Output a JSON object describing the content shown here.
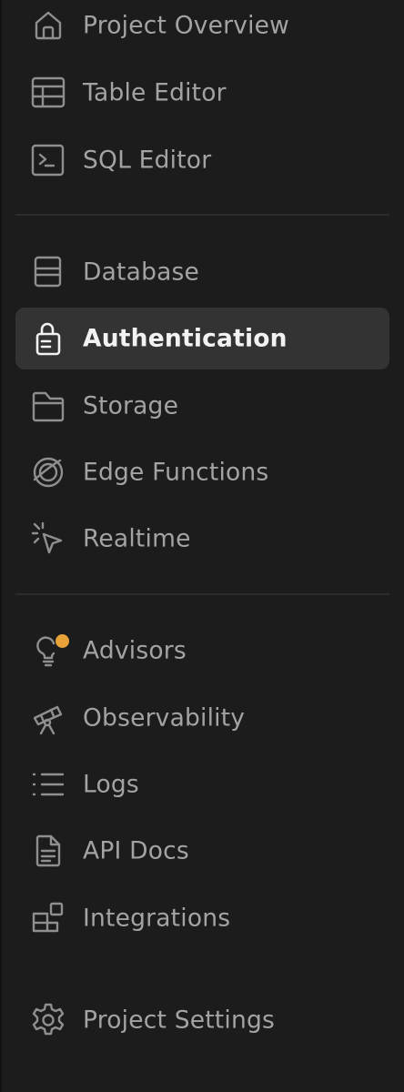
{
  "colors": {
    "background": "#1c1c1c",
    "active_background": "#333333",
    "text": "#a3a3a3",
    "active_text": "#f2f2f2",
    "icon": "#8f8f8f",
    "advisor_badge": "#e8a238"
  },
  "sidebar": {
    "groups": [
      {
        "items": [
          {
            "label": "Project Overview",
            "icon": "home-icon"
          },
          {
            "label": "Table Editor",
            "icon": "table-icon"
          },
          {
            "label": "SQL Editor",
            "icon": "terminal-icon"
          }
        ]
      },
      {
        "items": [
          {
            "label": "Database",
            "icon": "database-icon"
          },
          {
            "label": "Authentication",
            "icon": "lock-icon",
            "active": true
          },
          {
            "label": "Storage",
            "icon": "folder-icon"
          },
          {
            "label": "Edge Functions",
            "icon": "globe-icon"
          },
          {
            "label": "Realtime",
            "icon": "cursor-click-icon"
          }
        ]
      },
      {
        "items": [
          {
            "label": "Advisors",
            "icon": "lightbulb-icon",
            "badge": true
          },
          {
            "label": "Observability",
            "icon": "telescope-icon"
          },
          {
            "label": "Logs",
            "icon": "list-icon"
          },
          {
            "label": "API Docs",
            "icon": "document-icon"
          },
          {
            "label": "Integrations",
            "icon": "blocks-icon"
          }
        ]
      },
      {
        "items": [
          {
            "label": "Project Settings",
            "icon": "gear-icon"
          }
        ]
      }
    ]
  }
}
